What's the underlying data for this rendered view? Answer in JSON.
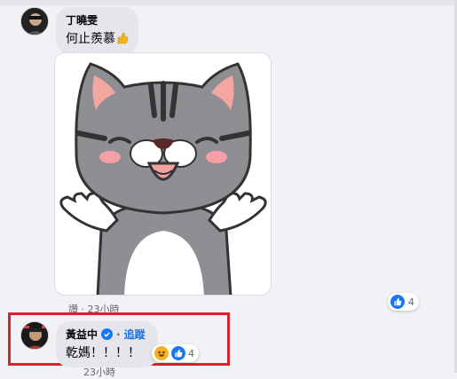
{
  "top": {
    "truncated_text": "…"
  },
  "comment1": {
    "author": "丁曉雯",
    "text": "何止羨慕",
    "emoji_icon": "thumbs-up"
  },
  "sticker": {
    "icon": "gray-tabby-cat-shrug-sticker",
    "meta_prefix": "讚",
    "meta_time": "23小時",
    "reaction_count": "4"
  },
  "comment2": {
    "author": "黃益中",
    "follow_label": "追蹤",
    "text": "乾媽！！！！",
    "reaction_count": "4"
  },
  "bottom": {
    "meta_time": "23小時"
  },
  "colors": {
    "highlight": "#d9202f",
    "follow_link": "#216fdb",
    "like_blue": "#1877f2",
    "bubble_gray": "#e4e6eb"
  }
}
